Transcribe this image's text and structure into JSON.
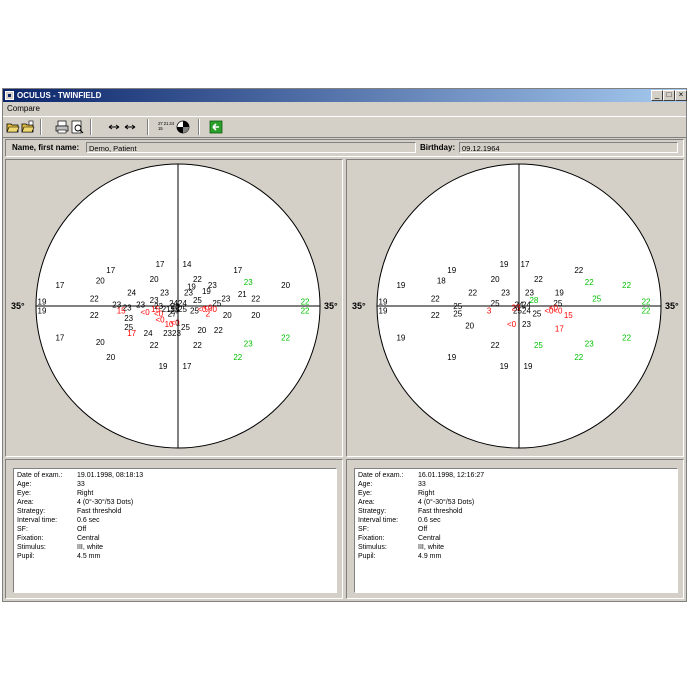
{
  "window": {
    "title": "OCULUS - TWINFIELD",
    "minimize": "_",
    "maximize": "□",
    "close": "×"
  },
  "menu": [
    "Compare"
  ],
  "toolbar": {
    "icons": [
      "open-folder-icon",
      "open-folder-2-icon",
      "print-icon",
      "print-preview-icon",
      "arrows-icon",
      "compare-numbers-icon",
      "gray-scale-icon",
      "back-icon"
    ],
    "numbers_icon_text": "27 21 24 15"
  },
  "patient": {
    "name_label": "Name, first name:",
    "name": "Demo, Patient",
    "birthday_label": "Birthday:",
    "birthday": "09.12.1964"
  },
  "colors": {
    "normal": "#000000",
    "defect": "#ff0000",
    "above": "#00c000"
  },
  "fields": [
    {
      "axis_left": "35°",
      "axis_right": "35°",
      "points": [
        {
          "x": -12,
          "y": -28,
          "v": "17",
          "c": "k"
        },
        {
          "x": 6,
          "y": -28,
          "v": "14",
          "c": "k"
        },
        {
          "x": -45,
          "y": -24,
          "v": "17",
          "c": "k"
        },
        {
          "x": 40,
          "y": -24,
          "v": "17",
          "c": "k"
        },
        {
          "x": -52,
          "y": -17,
          "v": "20",
          "c": "k"
        },
        {
          "x": -16,
          "y": -18,
          "v": "20",
          "c": "k"
        },
        {
          "x": 13,
          "y": -18,
          "v": "22",
          "c": "k"
        },
        {
          "x": 47,
          "y": -16,
          "v": "23",
          "c": "g"
        },
        {
          "x": -79,
          "y": -14,
          "v": "17",
          "c": "k"
        },
        {
          "x": 9,
          "y": -13,
          "v": "19",
          "c": "k"
        },
        {
          "x": 23,
          "y": -14,
          "v": "23",
          "c": "k"
        },
        {
          "x": 72,
          "y": -14,
          "v": "20",
          "c": "k"
        },
        {
          "x": -31,
          "y": -9,
          "v": "24",
          "c": "k"
        },
        {
          "x": -9,
          "y": -9,
          "v": "23",
          "c": "k"
        },
        {
          "x": 7,
          "y": -9,
          "v": "23",
          "c": "k"
        },
        {
          "x": 19,
          "y": -10,
          "v": "19",
          "c": "k"
        },
        {
          "x": 43,
          "y": -8,
          "v": "21",
          "c": "k"
        },
        {
          "x": -56,
          "y": -5,
          "v": "22",
          "c": "k"
        },
        {
          "x": -16,
          "y": -4,
          "v": "23",
          "c": "k"
        },
        {
          "x": 13,
          "y": -4,
          "v": "25",
          "c": "k"
        },
        {
          "x": 32,
          "y": -5,
          "v": "23",
          "c": "k"
        },
        {
          "x": 52,
          "y": -5,
          "v": "22",
          "c": "k"
        },
        {
          "x": -91,
          "y": -3,
          "v": "19",
          "c": "k"
        },
        {
          "x": -3,
          "y": -2,
          "v": "24",
          "c": "k"
        },
        {
          "x": 3,
          "y": -2,
          "v": "24",
          "c": "k"
        },
        {
          "x": 26,
          "y": -2,
          "v": "25",
          "c": "k"
        },
        {
          "x": 85,
          "y": -3,
          "v": "22",
          "c": "g"
        },
        {
          "x": -41,
          "y": -1,
          "v": "23",
          "c": "k"
        },
        {
          "x": -25,
          "y": -1,
          "v": "23",
          "c": "k"
        },
        {
          "x": -13,
          "y": 0,
          "v": "23",
          "c": "k"
        },
        {
          "x": -2,
          "y": 0,
          "v": "23",
          "c": "k"
        },
        {
          "x": 0,
          "y": 1,
          "v": "2",
          "c": "k"
        },
        {
          "x": 20,
          "y": 1,
          "v": "<0",
          "c": "r"
        },
        {
          "x": -34,
          "y": 1,
          "v": "23",
          "c": "k"
        },
        {
          "x": -15,
          "y": 2,
          "v": "15",
          "c": "r"
        },
        {
          "x": -8,
          "y": 2,
          "v": "21",
          "c": "k"
        },
        {
          "x": -2,
          "y": 2,
          "v": "25",
          "c": "k"
        },
        {
          "x": 3,
          "y": 2,
          "v": "25",
          "c": "k"
        },
        {
          "x": 16,
          "y": 2,
          "v": "<0",
          "c": "r"
        },
        {
          "x": 23,
          "y": 2,
          "v": "<0",
          "c": "r"
        },
        {
          "x": -91,
          "y": 3,
          "v": "19",
          "c": "k"
        },
        {
          "x": -38,
          "y": 3,
          "v": "15",
          "c": "r"
        },
        {
          "x": -2,
          "y": 3,
          "v": "27",
          "c": "k"
        },
        {
          "x": 11,
          "y": 3,
          "v": "25",
          "c": "k"
        },
        {
          "x": 85,
          "y": 3,
          "v": "22",
          "c": "g"
        },
        {
          "x": -22,
          "y": 4,
          "v": "<0",
          "c": "r"
        },
        {
          "x": -13,
          "y": 5,
          "v": "<0",
          "c": "r"
        },
        {
          "x": -4,
          "y": 5,
          "v": "27",
          "c": "k"
        },
        {
          "x": 20,
          "y": 5,
          "v": "2",
          "c": "r"
        },
        {
          "x": -56,
          "y": 6,
          "v": "22",
          "c": "k"
        },
        {
          "x": -33,
          "y": 8,
          "v": "23",
          "c": "k"
        },
        {
          "x": -12,
          "y": 9,
          "v": "<0",
          "c": "r"
        },
        {
          "x": -2,
          "y": 11,
          "v": "<0",
          "c": "r"
        },
        {
          "x": 0,
          "y": 11,
          "v": "1",
          "c": "k"
        },
        {
          "x": 33,
          "y": 6,
          "v": "20",
          "c": "k"
        },
        {
          "x": 52,
          "y": 6,
          "v": "20",
          "c": "k"
        },
        {
          "x": -33,
          "y": 14,
          "v": "25",
          "c": "k"
        },
        {
          "x": -6,
          "y": 12,
          "v": "10",
          "c": "r"
        },
        {
          "x": 5,
          "y": 14,
          "v": "25",
          "c": "k"
        },
        {
          "x": 16,
          "y": 16,
          "v": "20",
          "c": "k"
        },
        {
          "x": 27,
          "y": 16,
          "v": "22",
          "c": "k"
        },
        {
          "x": -31,
          "y": 18,
          "v": "17",
          "c": "r"
        },
        {
          "x": -20,
          "y": 18,
          "v": "24",
          "c": "k"
        },
        {
          "x": -4,
          "y": 18,
          "v": "2323",
          "c": "k"
        },
        {
          "x": -79,
          "y": 21,
          "v": "17",
          "c": "k"
        },
        {
          "x": 72,
          "y": 21,
          "v": "22",
          "c": "g"
        },
        {
          "x": -52,
          "y": 24,
          "v": "20",
          "c": "k"
        },
        {
          "x": -16,
          "y": 26,
          "v": "22",
          "c": "k"
        },
        {
          "x": 13,
          "y": 26,
          "v": "22",
          "c": "k"
        },
        {
          "x": 47,
          "y": 25,
          "v": "23",
          "c": "g"
        },
        {
          "x": -45,
          "y": 34,
          "v": "20",
          "c": "k"
        },
        {
          "x": 40,
          "y": 34,
          "v": "22",
          "c": "g"
        },
        {
          "x": -10,
          "y": 40,
          "v": "19",
          "c": "k"
        },
        {
          "x": 6,
          "y": 40,
          "v": "17",
          "c": "k"
        }
      ]
    },
    {
      "axis_left": "35°",
      "axis_right": "35°",
      "points": [
        {
          "x": -10,
          "y": -28,
          "v": "19",
          "c": "k"
        },
        {
          "x": 4,
          "y": -28,
          "v": "17",
          "c": "k"
        },
        {
          "x": -45,
          "y": -24,
          "v": "19",
          "c": "k"
        },
        {
          "x": 40,
          "y": -24,
          "v": "22",
          "c": "k"
        },
        {
          "x": -52,
          "y": -17,
          "v": "18",
          "c": "k"
        },
        {
          "x": -16,
          "y": -18,
          "v": "20",
          "c": "k"
        },
        {
          "x": 13,
          "y": -18,
          "v": "22",
          "c": "k"
        },
        {
          "x": 47,
          "y": -16,
          "v": "22",
          "c": "g"
        },
        {
          "x": -79,
          "y": -14,
          "v": "19",
          "c": "k"
        },
        {
          "x": 72,
          "y": -14,
          "v": "22",
          "c": "g"
        },
        {
          "x": -31,
          "y": -9,
          "v": "22",
          "c": "k"
        },
        {
          "x": -9,
          "y": -9,
          "v": "23",
          "c": "k"
        },
        {
          "x": 7,
          "y": -9,
          "v": "23",
          "c": "k"
        },
        {
          "x": 27,
          "y": -9,
          "v": "19",
          "c": "k"
        },
        {
          "x": -56,
          "y": -5,
          "v": "22",
          "c": "k"
        },
        {
          "x": 10,
          "y": -4,
          "v": "28",
          "c": "g"
        },
        {
          "x": 52,
          "y": -5,
          "v": "25",
          "c": "g"
        },
        {
          "x": -91,
          "y": -3,
          "v": "19",
          "c": "k"
        },
        {
          "x": -16,
          "y": -2,
          "v": "25",
          "c": "k"
        },
        {
          "x": 0,
          "y": -1,
          "v": "24",
          "c": "k"
        },
        {
          "x": 5,
          "y": -1,
          "v": "24",
          "c": "k"
        },
        {
          "x": 26,
          "y": -2,
          "v": "25",
          "c": "k"
        },
        {
          "x": 85,
          "y": -3,
          "v": "22",
          "c": "g"
        },
        {
          "x": -41,
          "y": 0,
          "v": "25",
          "c": "k"
        },
        {
          "x": -2,
          "y": 1,
          "v": "23",
          "c": "r"
        },
        {
          "x": 23,
          "y": 1,
          "v": "<0",
          "c": "r"
        },
        {
          "x": -91,
          "y": 3,
          "v": "19",
          "c": "k"
        },
        {
          "x": -20,
          "y": 3,
          "v": "3",
          "c": "r"
        },
        {
          "x": -1,
          "y": 3,
          "v": "25",
          "c": "k"
        },
        {
          "x": 5,
          "y": 3,
          "v": "24",
          "c": "k"
        },
        {
          "x": 20,
          "y": 3,
          "v": "<0",
          "c": "r"
        },
        {
          "x": 26,
          "y": 3,
          "v": "<0",
          "c": "r"
        },
        {
          "x": 85,
          "y": 3,
          "v": "22",
          "c": "g"
        },
        {
          "x": -56,
          "y": 6,
          "v": "22",
          "c": "k"
        },
        {
          "x": -41,
          "y": 5,
          "v": "25",
          "c": "k"
        },
        {
          "x": 12,
          "y": 5,
          "v": "25",
          "c": "k"
        },
        {
          "x": 33,
          "y": 6,
          "v": "15",
          "c": "r"
        },
        {
          "x": -33,
          "y": 13,
          "v": "20",
          "c": "k"
        },
        {
          "x": -5,
          "y": 12,
          "v": "<0",
          "c": "r"
        },
        {
          "x": 5,
          "y": 12,
          "v": "23",
          "c": "k"
        },
        {
          "x": 27,
          "y": 15,
          "v": "17",
          "c": "r"
        },
        {
          "x": -79,
          "y": 21,
          "v": "19",
          "c": "k"
        },
        {
          "x": 72,
          "y": 21,
          "v": "22",
          "c": "g"
        },
        {
          "x": -16,
          "y": 26,
          "v": "22",
          "c": "k"
        },
        {
          "x": 13,
          "y": 26,
          "v": "25",
          "c": "g"
        },
        {
          "x": 47,
          "y": 25,
          "v": "23",
          "c": "g"
        },
        {
          "x": -45,
          "y": 34,
          "v": "19",
          "c": "k"
        },
        {
          "x": 40,
          "y": 34,
          "v": "22",
          "c": "g"
        },
        {
          "x": -10,
          "y": 40,
          "v": "19",
          "c": "k"
        },
        {
          "x": 6,
          "y": 40,
          "v": "19",
          "c": "k"
        }
      ]
    }
  ],
  "exams": [
    {
      "rows": [
        {
          "k": "Date of exam.:",
          "v": "19.01.1998, 08:18:13"
        },
        {
          "k": "Age:",
          "v": "33"
        },
        {
          "k": "Eye:",
          "v": "Right"
        },
        {
          "k": "Area:",
          "v": "4 (0°-30°/53 Dots)"
        },
        {
          "k": "Strategy:",
          "v": "Fast threshold"
        },
        {
          "k": "Interval time:",
          "v": "0.6 sec"
        },
        {
          "k": "SF:",
          "v": "Off"
        },
        {
          "k": "Fixation:",
          "v": "Central"
        },
        {
          "k": "Stimulus:",
          "v": "III, white"
        },
        {
          "k": "Pupil:",
          "v": "4.5 mm"
        }
      ]
    },
    {
      "rows": [
        {
          "k": "Date of exam.:",
          "v": "16.01.1998, 12:16:27"
        },
        {
          "k": "Age:",
          "v": "33"
        },
        {
          "k": "Eye:",
          "v": "Right"
        },
        {
          "k": "Area:",
          "v": "4 (0°-30°/53 Dots)"
        },
        {
          "k": "Strategy:",
          "v": "Fast threshold"
        },
        {
          "k": "Interval time:",
          "v": "0.6 sec"
        },
        {
          "k": "SF:",
          "v": "Off"
        },
        {
          "k": "Fixation:",
          "v": "Central"
        },
        {
          "k": "Stimulus:",
          "v": "III, white"
        },
        {
          "k": "Pupil:",
          "v": "4.9 mm"
        }
      ]
    }
  ]
}
